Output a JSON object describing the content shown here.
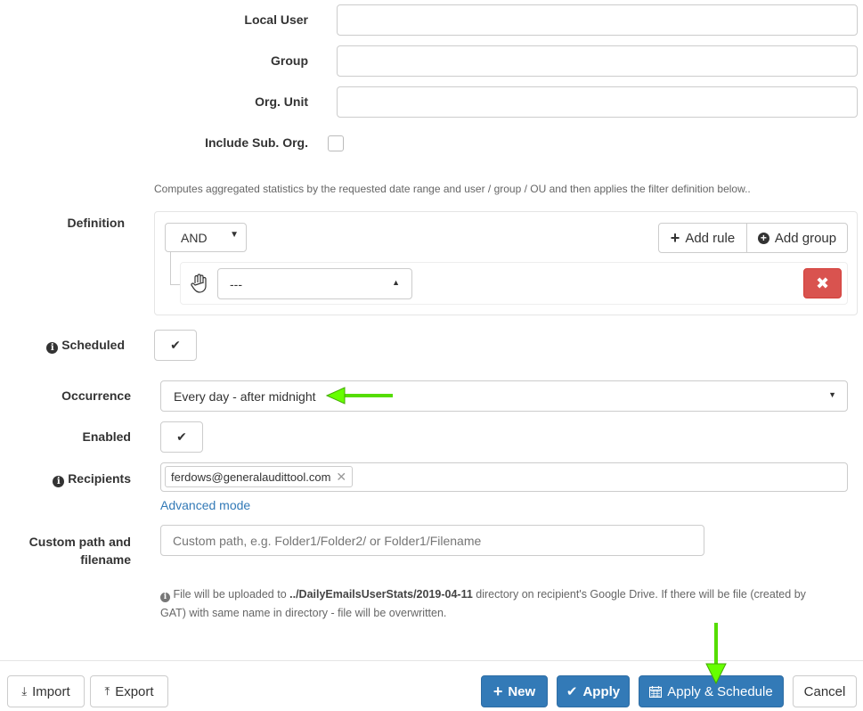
{
  "form": {
    "local_user_label": "Local User",
    "local_user_value": "",
    "group_label": "Group",
    "group_value": "",
    "org_unit_label": "Org. Unit",
    "org_unit_value": "",
    "include_sub_org_label": "Include Sub. Org.",
    "include_sub_org_checked": false
  },
  "definition": {
    "description": "Computes aggregated statistics by the requested date range and user / group / OU and then applies the filter definition below..",
    "label": "Definition",
    "operator": "AND",
    "add_rule_label": "Add rule",
    "add_group_label": "Add group",
    "rule_value": "---"
  },
  "schedule": {
    "scheduled_label": "Scheduled",
    "scheduled_checked": true,
    "occurrence_label": "Occurrence",
    "occurrence_value": "Every day - after midnight",
    "enabled_label": "Enabled",
    "enabled_checked": true,
    "recipients_label": "Recipients",
    "recipients": [
      "ferdows@generalaudittool.com"
    ],
    "advanced_mode_label": "Advanced mode",
    "custom_path_label_line1": "Custom path and",
    "custom_path_label_line2": "filename",
    "custom_path_placeholder": "Custom path, e.g. Folder1/Folder2/ or Folder1/Filename",
    "upload_note_prefix": "File will be uploaded to ",
    "upload_note_path": "../DailyEmailsUserStats/2019-04-11",
    "upload_note_line1_suffix": " directory on recipient's Google Drive. If there will be file (created by",
    "upload_note_line2": "GAT) with same name in directory - file will be overwritten."
  },
  "footer": {
    "import_label": "Import",
    "export_label": "Export",
    "new_label": "New",
    "apply_label": "Apply",
    "apply_schedule_label": "Apply & Schedule",
    "cancel_label": "Cancel"
  },
  "colors": {
    "primary": "#337ab7",
    "danger": "#d9534f",
    "link": "#337ab7",
    "annotation_arrow": "#66ff00"
  }
}
